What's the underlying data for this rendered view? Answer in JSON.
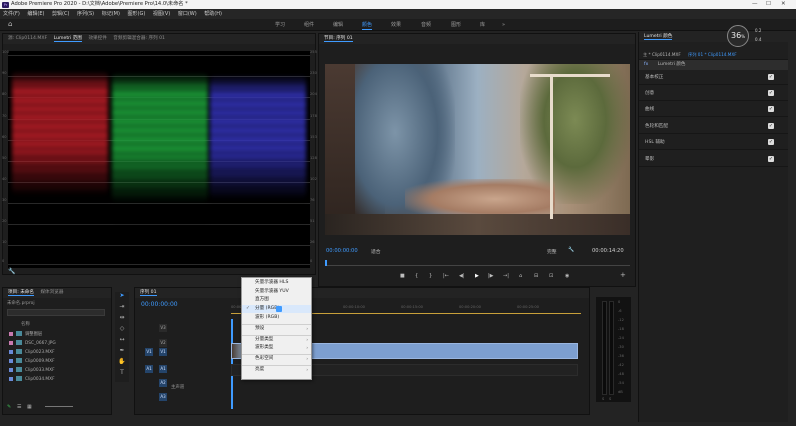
{
  "window": {
    "title": "Adobe Premiere Pro 2020 - D:\\文档\\Adobe\\Premiere Pro\\14.0\\未命名 *",
    "logo": "Pr",
    "minimize": "—",
    "maximize": "☐",
    "close": "✕"
  },
  "menu": [
    "文件(F)",
    "编辑(E)",
    "剪辑(C)",
    "序列(S)",
    "标记(M)",
    "图形(G)",
    "视图(V)",
    "窗口(W)",
    "帮助(H)"
  ],
  "workspaces": {
    "items": [
      "学习",
      "组件",
      "编辑",
      "颜色",
      "效果",
      "音频",
      "图形",
      "库"
    ],
    "active": "颜色",
    "more": "»"
  },
  "scopes_panel": {
    "tabs": [
      "源: Clip0114.MXF",
      "Lumetri 范围",
      "效果控件",
      "音频剪辑混合器: 序列 01"
    ],
    "active_tab": "Lumetri 范围",
    "left_ticks": [
      "100",
      "90",
      "80",
      "70",
      "60",
      "50",
      "40",
      "30",
      "20",
      "10",
      "0"
    ],
    "right_ticks": [
      "255",
      "230",
      "204",
      "178",
      "153",
      "128",
      "102",
      "76",
      "51",
      "26",
      "0"
    ],
    "wave_colors": [
      "#c8202a",
      "#20b040",
      "#3838c8"
    ],
    "menu_icon": "wrench-icon"
  },
  "program_monitor": {
    "title": "节目: 序列 01",
    "timecode_in": "00:00:00:00",
    "fit": "适合",
    "quality": "完整",
    "duration": "00:00:14:20",
    "controls": [
      "■",
      "{",
      "}",
      "|←",
      "◀|",
      "▶",
      "|▶",
      "→|",
      "⌂",
      "⊟",
      "⊡",
      "◉"
    ],
    "add": "+"
  },
  "lumetri": {
    "title": "Lumetri 颜色",
    "scale": "36",
    "scale_unit": "%",
    "meter_a": "0.2",
    "meter_b": "0.4",
    "clip_path_left": "主 * Clip0114.MXF",
    "clip_path_right": "序列 01 * Clip0114.MXF",
    "effect": "fx",
    "effect_name": "Lumetri 颜色",
    "sections": [
      "基本校正",
      "创意",
      "曲线",
      "色轮和匹配",
      "HSL 辅助",
      "晕影"
    ],
    "check": "✓"
  },
  "project": {
    "tabs": [
      "项目: 未命名",
      "媒体浏览器"
    ],
    "file": "未命名.prproj",
    "column_name": "名称",
    "items": [
      {
        "name": "调整图层",
        "color": "#c87ab0"
      },
      {
        "name": "DSC_0667.JPG",
        "color": "#c87ab0"
      },
      {
        "name": "Clip0023.MXF",
        "color": "#6a8ad8"
      },
      {
        "name": "Clip0009.MXF",
        "color": "#6a8ad8"
      },
      {
        "name": "Clip0033.MXF",
        "color": "#6a8ad8"
      },
      {
        "name": "Clip0034.MXF",
        "color": "#6a8ad8"
      }
    ]
  },
  "timeline": {
    "title": "序列 01",
    "timecode": "00:00:00:00",
    "ruler": [
      "00:00",
      "00:00:05:00",
      "00:00:10:00",
      "00:00:15:00",
      "00:00:20:00",
      "00:00:25:00"
    ],
    "tracks": [
      {
        "name": "V3"
      },
      {
        "name": "V2"
      },
      {
        "name": "V1"
      },
      {
        "name": "A1"
      },
      {
        "name": "A2"
      },
      {
        "name": "A3"
      }
    ],
    "master_label": "主声道",
    "meter_ticks": [
      "0",
      "-6",
      "-12",
      "-18",
      "-24",
      "-30",
      "-36",
      "-42",
      "-48",
      "-54",
      "dB"
    ],
    "meter_bottom": [
      "S",
      "S"
    ]
  },
  "context_menu": {
    "items": [
      {
        "label": "矢量示波器 HLS",
        "arrow": "",
        "state": "normal"
      },
      {
        "label": "矢量示波器 YUV",
        "arrow": "",
        "state": "normal"
      },
      {
        "label": "直方图",
        "arrow": "",
        "state": "normal"
      },
      {
        "label": "分量 (RGB)",
        "arrow": "",
        "state": "selected"
      },
      {
        "label": "波形 (RGB)",
        "arrow": "",
        "state": "normal"
      },
      {
        "label": "预设",
        "arrow": "›",
        "state": "normal"
      },
      {
        "label": "分量类型",
        "arrow": "›",
        "state": "normal"
      },
      {
        "label": "波形类型",
        "arrow": "›",
        "state": "normal"
      },
      {
        "label": "色彩空间",
        "arrow": "›",
        "state": "normal"
      },
      {
        "label": "亮度",
        "arrow": "›",
        "state": "normal"
      }
    ]
  }
}
